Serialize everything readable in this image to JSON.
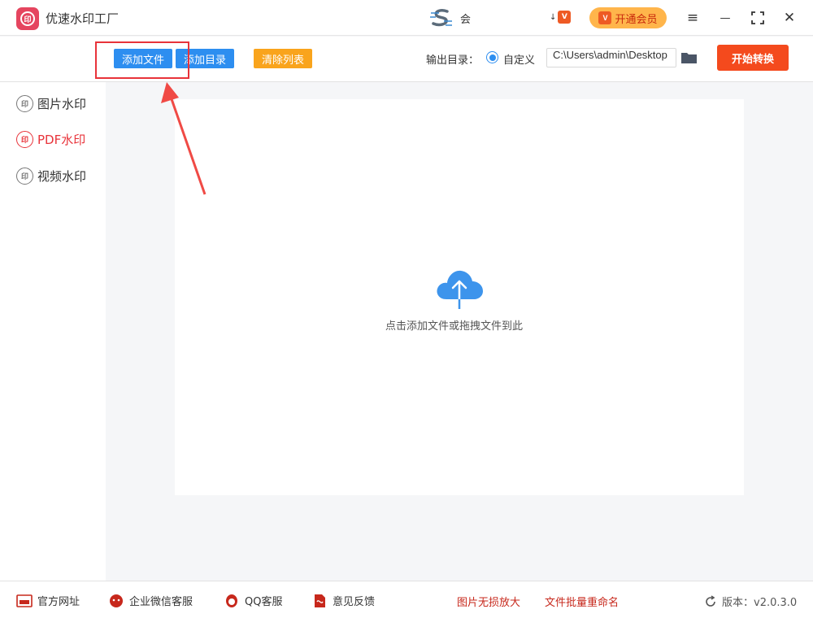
{
  "app": {
    "title": "优速水印工厂",
    "logo_glyph": "印"
  },
  "header": {
    "user_name": "会",
    "small_badge_prefix": "↓",
    "small_badge_glyph": "V",
    "vip_label": "开通会员",
    "vip_badge_glyph": "V",
    "window_controls": {
      "menu": "≡",
      "minimize": "—",
      "maximize": "⛶",
      "close": "✕"
    }
  },
  "toolbar": {
    "add_file_label": "添加文件",
    "add_dir_label": "添加目录",
    "clear_list_label": "清除列表",
    "output_dir_label": "输出目录：",
    "custom_label": "自定义",
    "output_path": "C:\\Users\\admin\\Desktop",
    "start_label": "开始转换"
  },
  "sidebar": {
    "items": [
      {
        "label": "图片水印",
        "icon": "印",
        "active": false
      },
      {
        "label": "PDF水印",
        "icon": "印",
        "active": true
      },
      {
        "label": "视频水印",
        "icon": "印",
        "active": false
      }
    ]
  },
  "main": {
    "drop_hint": "点击添加文件或拖拽文件到此"
  },
  "footer": {
    "website_label": "官方网址",
    "wechat_label": "企业微信客服",
    "qq_label": "QQ客服",
    "feedback_label": "意见反馈",
    "link_image_enlarge": "图片无损放大",
    "link_batch_rename": "文件批量重命名",
    "version_label": "版本：v2.0.3.0"
  },
  "colors": {
    "accent_blue": "#2d8ef0",
    "accent_orange": "#f9a41c",
    "start_red": "#f44a1d",
    "active_red": "#e8333a",
    "vip_gold": "#ffb54b"
  }
}
